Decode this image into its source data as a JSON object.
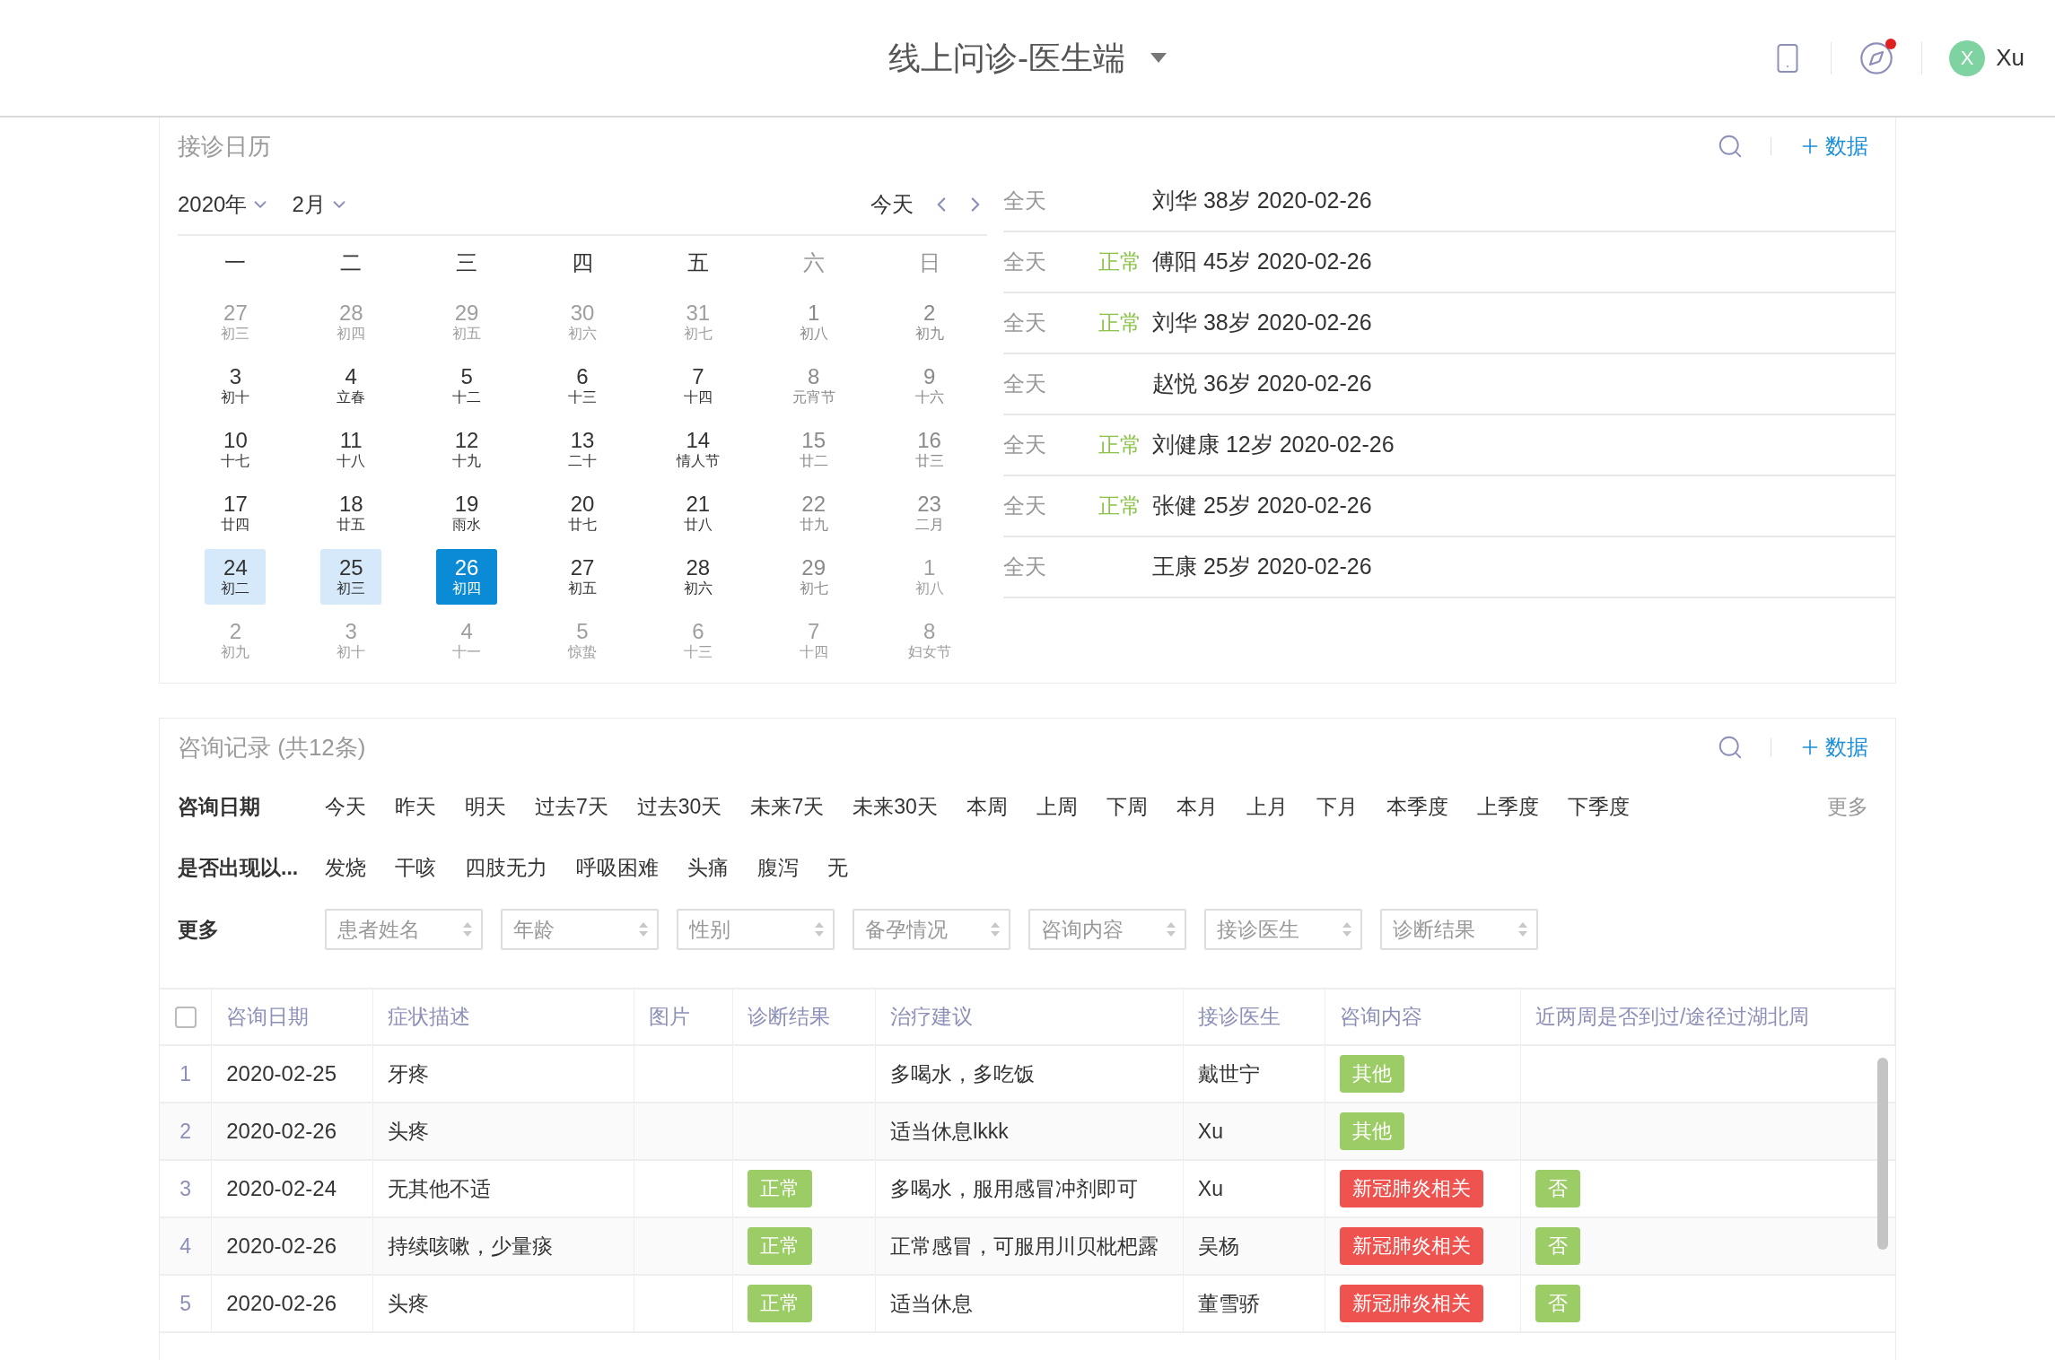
{
  "header": {
    "title": "线上问诊-医生端",
    "user": {
      "initial": "X",
      "name": "Xu"
    },
    "notification": true
  },
  "calendar_card": {
    "title": "接诊日历",
    "add_label": "数据",
    "year": "2020年",
    "month": "2月",
    "today": "今天",
    "weekdays": [
      "一",
      "二",
      "三",
      "四",
      "五",
      "六",
      "日"
    ],
    "days": [
      {
        "day": "27",
        "lunar": "初三",
        "other_month": true,
        "selected": false,
        "in_range": false
      },
      {
        "day": "28",
        "lunar": "初四",
        "other_month": true,
        "selected": false,
        "in_range": false
      },
      {
        "day": "29",
        "lunar": "初五",
        "other_month": true,
        "selected": false,
        "in_range": false
      },
      {
        "day": "30",
        "lunar": "初六",
        "other_month": true,
        "selected": false,
        "in_range": false
      },
      {
        "day": "31",
        "lunar": "初七",
        "other_month": true,
        "selected": false,
        "in_range": false
      },
      {
        "day": "1",
        "lunar": "初八",
        "other_month": false,
        "selected": false,
        "in_range": false
      },
      {
        "day": "2",
        "lunar": "初九",
        "other_month": false,
        "selected": false,
        "in_range": false
      },
      {
        "day": "3",
        "lunar": "初十",
        "other_month": false,
        "selected": false,
        "in_range": false
      },
      {
        "day": "4",
        "lunar": "立春",
        "other_month": false,
        "selected": false,
        "in_range": false
      },
      {
        "day": "5",
        "lunar": "十二",
        "other_month": false,
        "selected": false,
        "in_range": false
      },
      {
        "day": "6",
        "lunar": "十三",
        "other_month": false,
        "selected": false,
        "in_range": false
      },
      {
        "day": "7",
        "lunar": "十四",
        "other_month": false,
        "selected": false,
        "in_range": false
      },
      {
        "day": "8",
        "lunar": "元宵节",
        "other_month": false,
        "selected": false,
        "in_range": false
      },
      {
        "day": "9",
        "lunar": "十六",
        "other_month": false,
        "selected": false,
        "in_range": false
      },
      {
        "day": "10",
        "lunar": "十七",
        "other_month": false,
        "selected": false,
        "in_range": false
      },
      {
        "day": "11",
        "lunar": "十八",
        "other_month": false,
        "selected": false,
        "in_range": false
      },
      {
        "day": "12",
        "lunar": "十九",
        "other_month": false,
        "selected": false,
        "in_range": false
      },
      {
        "day": "13",
        "lunar": "二十",
        "other_month": false,
        "selected": false,
        "in_range": false
      },
      {
        "day": "14",
        "lunar": "情人节",
        "other_month": false,
        "selected": false,
        "in_range": false
      },
      {
        "day": "15",
        "lunar": "廿二",
        "other_month": false,
        "selected": false,
        "in_range": false
      },
      {
        "day": "16",
        "lunar": "廿三",
        "other_month": false,
        "selected": false,
        "in_range": false
      },
      {
        "day": "17",
        "lunar": "廿四",
        "other_month": false,
        "selected": false,
        "in_range": false
      },
      {
        "day": "18",
        "lunar": "廿五",
        "other_month": false,
        "selected": false,
        "in_range": false
      },
      {
        "day": "19",
        "lunar": "雨水",
        "other_month": false,
        "selected": false,
        "in_range": false
      },
      {
        "day": "20",
        "lunar": "廿七",
        "other_month": false,
        "selected": false,
        "in_range": false
      },
      {
        "day": "21",
        "lunar": "廿八",
        "other_month": false,
        "selected": false,
        "in_range": false
      },
      {
        "day": "22",
        "lunar": "廿九",
        "other_month": false,
        "selected": false,
        "in_range": false
      },
      {
        "day": "23",
        "lunar": "二月",
        "other_month": false,
        "selected": false,
        "in_range": false
      },
      {
        "day": "24",
        "lunar": "初二",
        "other_month": false,
        "selected": false,
        "in_range": true
      },
      {
        "day": "25",
        "lunar": "初三",
        "other_month": false,
        "selected": false,
        "in_range": true
      },
      {
        "day": "26",
        "lunar": "初四",
        "other_month": false,
        "selected": true,
        "in_range": false
      },
      {
        "day": "27",
        "lunar": "初五",
        "other_month": false,
        "selected": false,
        "in_range": false
      },
      {
        "day": "28",
        "lunar": "初六",
        "other_month": false,
        "selected": false,
        "in_range": false
      },
      {
        "day": "29",
        "lunar": "初七",
        "other_month": false,
        "selected": false,
        "in_range": false
      },
      {
        "day": "1",
        "lunar": "初八",
        "other_month": true,
        "selected": false,
        "in_range": false
      },
      {
        "day": "2",
        "lunar": "初九",
        "other_month": true,
        "selected": false,
        "in_range": false
      },
      {
        "day": "3",
        "lunar": "初十",
        "other_month": true,
        "selected": false,
        "in_range": false
      },
      {
        "day": "4",
        "lunar": "十一",
        "other_month": true,
        "selected": false,
        "in_range": false
      },
      {
        "day": "5",
        "lunar": "惊蛰",
        "other_month": true,
        "selected": false,
        "in_range": false
      },
      {
        "day": "6",
        "lunar": "十三",
        "other_month": true,
        "selected": false,
        "in_range": false
      },
      {
        "day": "7",
        "lunar": "十四",
        "other_month": true,
        "selected": false,
        "in_range": false
      },
      {
        "day": "8",
        "lunar": "妇女节",
        "other_month": true,
        "selected": false,
        "in_range": false
      }
    ],
    "events": [
      {
        "time": "全天",
        "text": "刘华 38岁 2020-02-26"
      },
      {
        "time": "全天",
        "status": "正常",
        "text": "傅阳 45岁 2020-02-26"
      },
      {
        "time": "全天",
        "status": "正常",
        "text": "刘华 38岁 2020-02-26"
      },
      {
        "time": "全天",
        "text": "赵悦 36岁 2020-02-26"
      },
      {
        "time": "全天",
        "status": "正常",
        "text": "刘健康 12岁 2020-02-26"
      },
      {
        "time": "全天",
        "status": "正常",
        "text": "张健 25岁 2020-02-26"
      },
      {
        "time": "全天",
        "text": "王康 25岁 2020-02-26"
      }
    ]
  },
  "records_card": {
    "title": "咨询记录 (共12条)",
    "add_label": "数据",
    "date_filter": {
      "label": "咨询日期",
      "options": [
        "今天",
        "昨天",
        "明天",
        "过去7天",
        "过去30天",
        "未来7天",
        "未来30天",
        "本周",
        "上周",
        "下周",
        "本月",
        "上月",
        "下月",
        "本季度",
        "上季度",
        "下季度"
      ],
      "more": "更多"
    },
    "symptom_filter": {
      "label": "是否出现以...",
      "options": [
        "发烧",
        "干咳",
        "四肢无力",
        "呼吸困难",
        "头痛",
        "腹泻",
        "无"
      ]
    },
    "more_filter": {
      "label": "更多",
      "selects": [
        {
          "placeholder": "患者姓名"
        },
        {
          "placeholder": "年龄"
        },
        {
          "placeholder": "性别"
        },
        {
          "placeholder": "备孕情况"
        },
        {
          "placeholder": "咨询内容"
        },
        {
          "placeholder": "接诊医生"
        },
        {
          "placeholder": "诊断结果"
        }
      ]
    },
    "table": {
      "select_all_checked": false,
      "columns": [
        "咨询日期",
        "症状描述",
        "图片",
        "诊断结果",
        "治疗建议",
        "接诊医生",
        "咨询内容",
        "近两周是否到过/途径过湖北周"
      ],
      "rows": [
        {
          "index": "1",
          "date": "2020-02-25",
          "symptom": "牙疼",
          "advice": "多喝水，多吃饭",
          "doctor": "戴世宁",
          "content": {
            "text": "其他",
            "color": "#9ccc65"
          }
        },
        {
          "index": "2",
          "date": "2020-02-26",
          "symptom": "头疼",
          "advice": "适当休息lkkk",
          "doctor": "Xu",
          "content": {
            "text": "其他",
            "color": "#9ccc65"
          }
        },
        {
          "index": "3",
          "date": "2020-02-24",
          "symptom": "无其他不适",
          "diagnosis": {
            "text": "正常",
            "color": "#9ccc65"
          },
          "advice": "多喝水，服用感冒冲剂即可",
          "doctor": "Xu",
          "content": {
            "text": "新冠肺炎相关",
            "color": "#ef5350"
          },
          "hubei": {
            "text": "否",
            "color": "#9ccc65"
          }
        },
        {
          "index": "4",
          "date": "2020-02-26",
          "symptom": "持续咳嗽，少量痰",
          "diagnosis": {
            "text": "正常",
            "color": "#9ccc65"
          },
          "advice": "正常感冒，可服用川贝枇杷露",
          "doctor": "吴杨",
          "content": {
            "text": "新冠肺炎相关",
            "color": "#ef5350"
          },
          "hubei": {
            "text": "否",
            "color": "#9ccc65"
          }
        },
        {
          "index": "5",
          "date": "2020-02-26",
          "symptom": "头疼",
          "diagnosis": {
            "text": "正常",
            "color": "#9ccc65"
          },
          "advice": "适当休息",
          "doctor": "董雪骄",
          "content": {
            "text": "新冠肺炎相关",
            "color": "#ef5350"
          },
          "hubei": {
            "text": "否",
            "color": "#9ccc65"
          }
        }
      ]
    }
  }
}
